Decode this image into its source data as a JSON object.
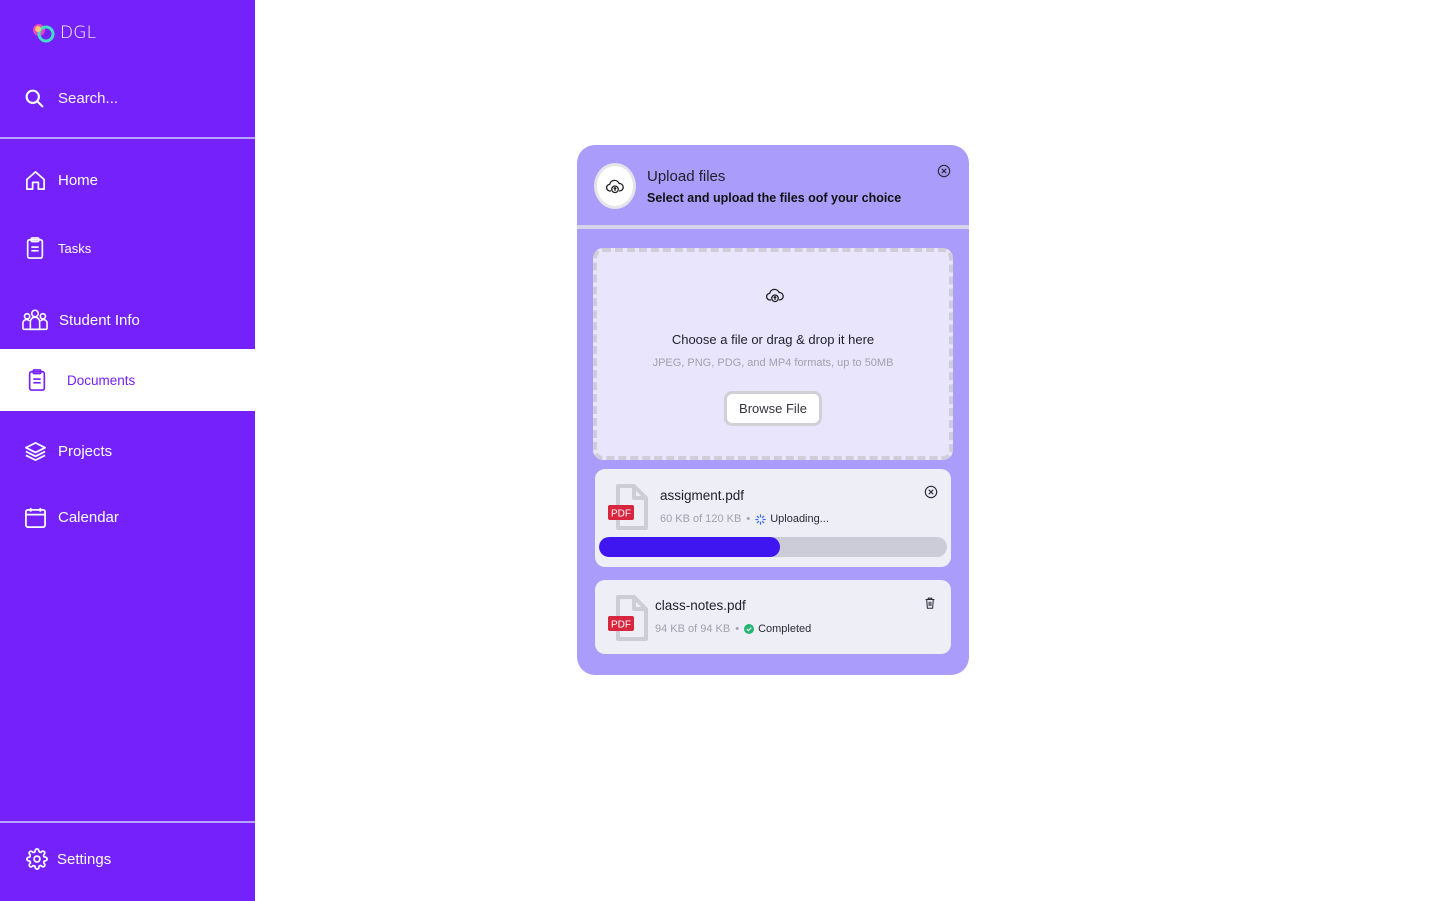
{
  "app": {
    "logo_text": "DGL"
  },
  "sidebar": {
    "search_placeholder": "Search...",
    "items": [
      {
        "label": "Home",
        "icon": "home-icon"
      },
      {
        "label": "Tasks",
        "icon": "clipboard-icon"
      },
      {
        "label": "Student Info",
        "icon": "users-icon"
      },
      {
        "label": "Documents",
        "icon": "clipboard-icon",
        "active": true
      },
      {
        "label": "Projects",
        "icon": "layers-icon"
      },
      {
        "label": "Calendar",
        "icon": "calendar-icon"
      }
    ],
    "settings_label": "Settings"
  },
  "upload": {
    "title": "Upload files",
    "subtitle": "Select and upload the files oof your choice",
    "dropzone_title": "Choose a file or drag & drop it here",
    "dropzone_sub": "JPEG, PNG, PDG, and MP4 formats, up to 50MB",
    "browse_label": "Browse File",
    "files": [
      {
        "name": "assigment.pdf",
        "badge": "PDF",
        "size": "60 KB of 120 KB",
        "separator": "•",
        "status": "Uploading...",
        "progress": 0.52
      },
      {
        "name": "class-notes.pdf",
        "badge": "PDF",
        "size": "94 KB of 94 KB",
        "separator": "•",
        "status": "Completed"
      }
    ]
  },
  "colors": {
    "sidebar_bg": "#7421fb",
    "card_bg": "#aa9cfb",
    "progress_fill": "#3f15f0",
    "completed": "#22b573",
    "pdf_badge": "#d7263d"
  }
}
